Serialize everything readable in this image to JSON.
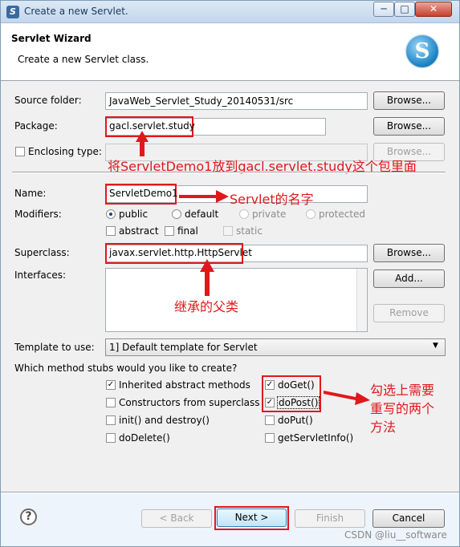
{
  "window": {
    "title": "Create a new Servlet.",
    "min_symbol": "─",
    "max_symbol": "□",
    "close_symbol": "✕"
  },
  "header": {
    "title": "Servlet Wizard",
    "description": "Create a new Servlet class."
  },
  "form": {
    "source_folder_label": "Source folder:",
    "source_folder_value": "JavaWeb_Servlet_Study_20140531/src",
    "package_label": "Package:",
    "package_value": "gacl.servlet.study",
    "enclosing_type_label": "Enclosing type:",
    "name_label": "Name:",
    "name_value": "ServletDemo1",
    "modifiers_label": "Modifiers:",
    "modifiers": [
      "public",
      "default",
      "private",
      "protected"
    ],
    "modifiers_extra": [
      "abstract",
      "final",
      "static"
    ],
    "superclass_label": "Superclass:",
    "superclass_value": "javax.servlet.http.HttpServlet",
    "interfaces_label": "Interfaces:",
    "template_label": "Template to use:",
    "template_value": "1] Default template for Servlet",
    "stubs_label": "Which method stubs would you like to create?",
    "stubs_left": [
      "Inherited abstract methods",
      "Constructors from superclass",
      "init() and destroy()",
      "doDelete()"
    ],
    "stubs_right": [
      "doGet()",
      "doPost()",
      "doPut()",
      "getServletInfo()"
    ]
  },
  "buttons": {
    "browse": "Browse...",
    "add": "Add...",
    "remove": "Remove",
    "back": "< Back",
    "next": "Next >",
    "finish": "Finish",
    "cancel": "Cancel",
    "help": "?"
  },
  "annotations": {
    "package_note": "将ServletDemo1放到gacl.servlet.study这个包里面",
    "name_note": "Servlet的名字",
    "superclass_note": "继承的父类",
    "stubs_note_1": "勾选上需要",
    "stubs_note_2": "重写的两个",
    "stubs_note_3": "方法"
  },
  "watermark": "CSDN @liu__software",
  "colors": {
    "annotation_red": "#e0181c",
    "focus_blue": "#1f3f8a"
  }
}
